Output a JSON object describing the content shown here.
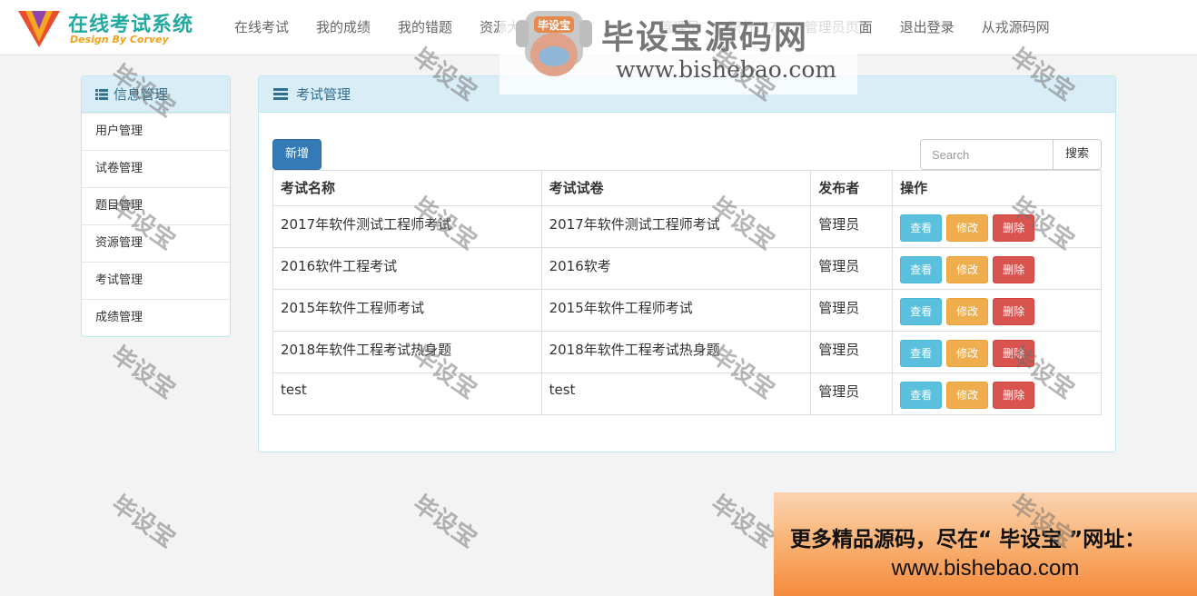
{
  "brand": {
    "title": "在线考试系统",
    "subtitle": "Design By Corvey",
    "colors": {
      "title": "#22a9a0",
      "subtitle": "#f0a21c"
    }
  },
  "nav": {
    "items": [
      {
        "label": "在线考试"
      },
      {
        "label": "我的成绩"
      },
      {
        "label": "我的错题"
      },
      {
        "label": "资源大全"
      },
      {
        "label": "管理员"
      },
      {
        "label": "积分：7"
      },
      {
        "label": "管理员页面"
      },
      {
        "label": "退出登录"
      },
      {
        "label": "从戎源码网"
      }
    ]
  },
  "sidebar": {
    "title": "信息管理",
    "title_icon": "list-icon",
    "items": [
      {
        "label": "用户管理"
      },
      {
        "label": "试卷管理"
      },
      {
        "label": "题目管理"
      },
      {
        "label": "资源管理"
      },
      {
        "label": "考试管理"
      },
      {
        "label": "成绩管理"
      }
    ]
  },
  "main": {
    "title": "考试管理",
    "title_icon": "bars-icon",
    "add_label": "新增",
    "search": {
      "placeholder": "Search",
      "value": "",
      "button_label": "搜索"
    },
    "table": {
      "headers": [
        "考试名称",
        "考试试卷",
        "发布者",
        "操作"
      ],
      "actions": {
        "view": "查看",
        "edit": "修改",
        "delete": "删除"
      },
      "rows": [
        {
          "name": "2017年软件测试工程师考试",
          "paper": "2017年软件测试工程师考试",
          "publisher": "管理员"
        },
        {
          "name": "2016软件工程考试",
          "paper": "2016软考",
          "publisher": "管理员"
        },
        {
          "name": "2015年软件工程师考试",
          "paper": "2015年软件工程师考试",
          "publisher": "管理员"
        },
        {
          "name": "2018年软件工程考试热身题",
          "paper": "2018年软件工程考试热身题",
          "publisher": "管理员"
        },
        {
          "name": "test",
          "paper": "test",
          "publisher": "管理员"
        }
      ]
    }
  },
  "watermark": {
    "text": "毕设宝",
    "logo_title": "毕设宝源码网",
    "logo_badge": "毕设宝",
    "logo_url": "www.bishebao.com",
    "promo_line1": "更多精品源码，尽在“ 毕设宝 ”网址：",
    "promo_line2": "www.bishebao.com"
  },
  "colors": {
    "primary": "#337ab7",
    "info": "#5bc0de",
    "warning": "#f0ad4e",
    "danger": "#d9534f",
    "panel_head": "#d9edf7"
  }
}
